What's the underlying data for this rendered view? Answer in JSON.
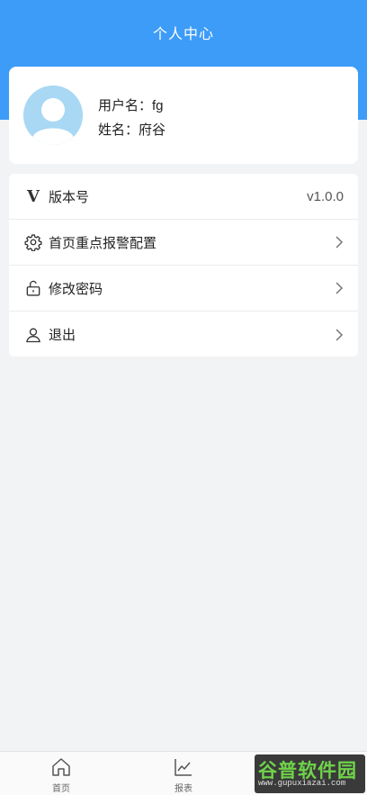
{
  "header": {
    "title": "个人中心",
    "bg_color": "#3d9cf7"
  },
  "profile": {
    "username_label": "用户名：",
    "username": "fg",
    "name_label": "姓名：",
    "name": "府谷",
    "avatar_color": "#a9d8f5"
  },
  "menu": {
    "items": [
      {
        "icon": "version-v-icon",
        "label": "版本号",
        "value": "v1.0.0"
      },
      {
        "icon": "gear-icon",
        "label": "首页重点报警配置",
        "value": ""
      },
      {
        "icon": "unlock-icon",
        "label": "修改密码",
        "value": ""
      },
      {
        "icon": "user-icon",
        "label": "退出",
        "value": ""
      }
    ]
  },
  "tabbar": {
    "tabs": [
      {
        "icon": "home-icon",
        "label": "首页"
      },
      {
        "icon": "line-chart-icon",
        "label": "报表"
      }
    ]
  },
  "watermark": {
    "main": "谷普软件园",
    "sub": "www.gupuxiazai.com"
  }
}
